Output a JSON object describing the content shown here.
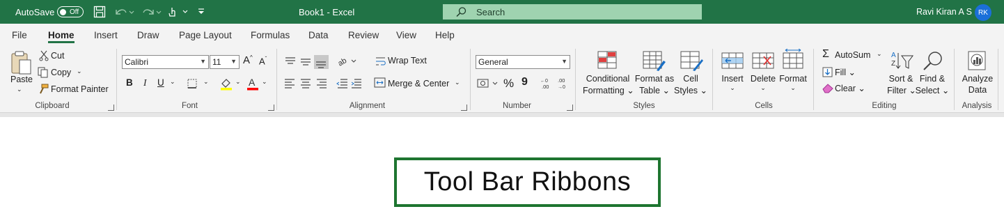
{
  "titlebar": {
    "autosave_label": "AutoSave",
    "autosave_state": "Off",
    "title": "Book1  -  Excel",
    "search_placeholder": "Search",
    "user_name": "Ravi Kiran A S",
    "user_initials": "RK"
  },
  "tabs": [
    "File",
    "Home",
    "Insert",
    "Draw",
    "Page Layout",
    "Formulas",
    "Data",
    "Review",
    "View",
    "Help"
  ],
  "active_tab": "Home",
  "clipboard": {
    "paste": "Paste",
    "cut": "Cut",
    "copy": "Copy",
    "format_painter": "Format Painter",
    "group": "Clipboard"
  },
  "font": {
    "name": "Calibri",
    "size": "11",
    "bold": "B",
    "italic": "I",
    "underline": "U",
    "group": "Font"
  },
  "alignment": {
    "wrap_text": "Wrap Text",
    "merge_center": "Merge & Center",
    "group": "Alignment"
  },
  "number": {
    "format": "General",
    "percent": "%",
    "comma": "9",
    "group": "Number"
  },
  "styles": {
    "conditional_1": "Conditional",
    "conditional_2": "Formatting",
    "format_table_1": "Format as",
    "format_table_2": "Table",
    "cell_styles_1": "Cell",
    "cell_styles_2": "Styles",
    "group": "Styles"
  },
  "cells": {
    "insert": "Insert",
    "delete": "Delete",
    "format": "Format",
    "group": "Cells"
  },
  "editing": {
    "autosum": "AutoSum",
    "fill": "Fill",
    "clear": "Clear",
    "sort_1": "Sort &",
    "sort_2": "Filter",
    "find_1": "Find &",
    "find_2": "Select",
    "group": "Editing"
  },
  "analysis": {
    "analyze_1": "Analyze",
    "analyze_2": "Data",
    "group": "Analysis"
  },
  "caption": "Tool Bar Ribbons",
  "colors": {
    "title_bar": "#217346",
    "highlight": "#ffff00",
    "font_color": "#ff0000",
    "caption_border": "#1e7530"
  }
}
